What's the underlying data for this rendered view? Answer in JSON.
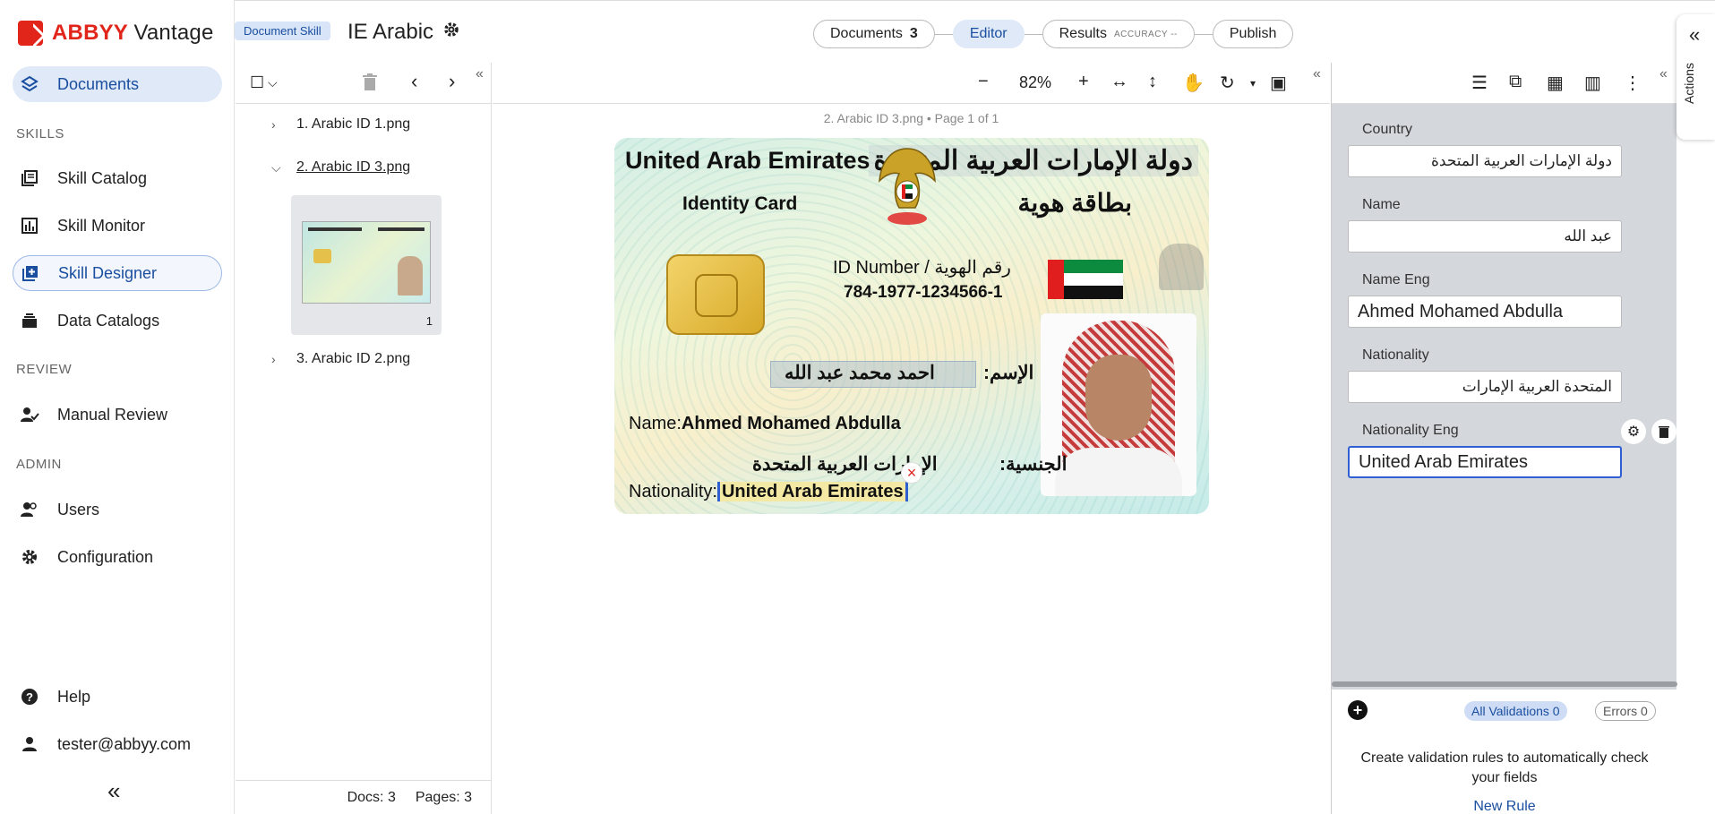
{
  "brand": {
    "name_red": "ABBYY",
    "name_rest": "Vantage"
  },
  "sidebar": {
    "documents": "Documents",
    "skills_section": "SKILLS",
    "skill_catalog": "Skill Catalog",
    "skill_monitor": "Skill Monitor",
    "skill_designer": "Skill Designer",
    "data_catalogs": "Data Catalogs",
    "review_section": "REVIEW",
    "manual_review": "Manual Review",
    "admin_section": "ADMIN",
    "users": "Users",
    "configuration": "Configuration",
    "help": "Help",
    "user": "tester@abbyy.com",
    "collapse": "«"
  },
  "header": {
    "badge": "Document Skill",
    "title": "IE Arabic",
    "steps": {
      "documents_label": "Documents",
      "documents_count": "3",
      "editor": "Editor",
      "results": "Results",
      "accuracy": "ACCURACY --",
      "publish": "Publish"
    }
  },
  "docs": {
    "items": [
      {
        "label": "1. Arabic ID 1.png"
      },
      {
        "label": "2. Arabic ID 3.png"
      },
      {
        "label": "3. Arabic ID 2.png"
      }
    ],
    "thumb_page": "1",
    "footer_docs": "Docs: 3",
    "footer_pages": "Pages: 3"
  },
  "viewer": {
    "zoom": "82%",
    "caption": "2. Arabic ID 3.png • Page 1 of 1",
    "card": {
      "en_title": "United Arab Emirates",
      "en_sub": "Identity Card",
      "ar_title": "دولة الإمارات العربية المتحدة",
      "ar_sub": "بطاقة هوية",
      "id_label": "ID Number / رقم الهوية",
      "id_number": "784-1977-1234566-1",
      "ar_name_label": "الإسم:",
      "ar_name": "احمد محمد عبد الله",
      "en_name_label": "Name:",
      "en_name": "Ahmed Mohamed Abdulla",
      "ar_nat_label": "الجنسية:",
      "ar_nat": "الإمارات العربية المتحدة",
      "en_nat_label": "Nationality:",
      "en_nat": "United Arab Emirates"
    }
  },
  "fields": {
    "country_label": "Country",
    "country_value": "دولة الإمارات العربية المتحدة",
    "name_label": "Name",
    "name_value": "عبد الله",
    "name_eng_label": "Name Eng",
    "name_eng_value": "Ahmed Mohamed Abdulla",
    "nationality_label": "Nationality",
    "nationality_value": "المتحدة العربية الإمارات",
    "nationality_eng_label": "Nationality Eng",
    "nationality_eng_value": "United Arab Emirates"
  },
  "validation": {
    "all": "All Validations 0",
    "errors": "Errors 0",
    "help": "Create validation rules to automatically check your fields",
    "new_rule": "New Rule"
  },
  "actions": {
    "label": "Actions"
  }
}
